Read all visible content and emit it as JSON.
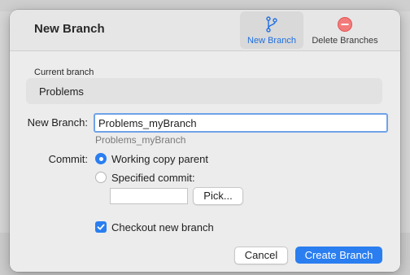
{
  "sheet": {
    "title": "New Branch",
    "toolbar": {
      "new_branch_label": "New Branch",
      "delete_branches_label": "Delete Branches"
    }
  },
  "current_branch": {
    "label": "Current branch",
    "value": "Problems"
  },
  "new_branch": {
    "label": "New Branch:",
    "value": "Problems_myBranch",
    "hint": "Problems_myBranch"
  },
  "commit": {
    "label": "Commit:",
    "options": [
      {
        "label": "Working copy parent",
        "selected": true
      },
      {
        "label": "Specified commit:",
        "selected": false
      }
    ],
    "specified_value": "",
    "pick_label": "Pick..."
  },
  "checkout": {
    "label": "Checkout new branch",
    "checked": true
  },
  "actions": {
    "cancel_label": "Cancel",
    "create_label": "Create Branch"
  },
  "colors": {
    "accent": "#2a7ef0",
    "delete_icon": "#f06a6a"
  },
  "icons": {
    "new_branch": "branch-icon",
    "delete_branches": "delete-circle-icon"
  }
}
